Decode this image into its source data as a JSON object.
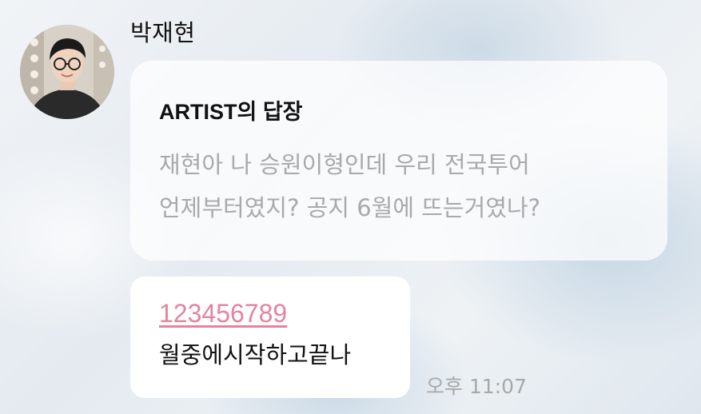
{
  "sender": {
    "name": "박재현",
    "avatar_icon": "profile-photo"
  },
  "reply": {
    "title": "ARTIST의 답장",
    "quoted_line1": "재현아 나 승원이형인데 우리 전국투어",
    "quoted_line2": "언제부터였지? 공지 6월에 뜨는거였나?"
  },
  "message": {
    "link_text": "123456789",
    "text": "월중에시작하고끝나",
    "timestamp": "오후 11:07"
  },
  "colors": {
    "link": "#e3849e",
    "quoted_text": "#a9a9a9",
    "background": "#e9edf1"
  }
}
